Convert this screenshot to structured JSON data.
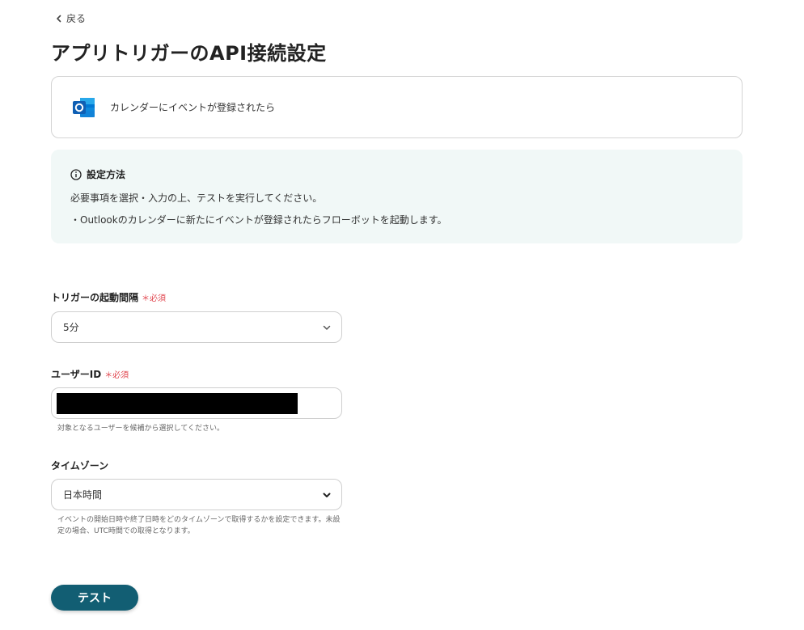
{
  "nav": {
    "back_label": "戻る"
  },
  "page": {
    "title": "アプリトリガーのAPI接続設定"
  },
  "trigger": {
    "app_icon": "outlook-icon",
    "label": "カレンダーにイベントが登録されたら"
  },
  "info": {
    "heading": "設定方法",
    "lines": [
      "必要事項を選択・入力の上、テストを実行してください。",
      "・Outlookのカレンダーに新たにイベントが登録されたらフローボットを起動します。"
    ]
  },
  "fields": {
    "interval": {
      "label": "トリガーの起動間隔",
      "required": "＊必須",
      "value": "5分"
    },
    "user_id": {
      "label": "ユーザーID",
      "required": "＊必須",
      "value": "",
      "help": "対象となるユーザーを候補から選択してください。"
    },
    "timezone": {
      "label": "タイムゾーン",
      "value": "日本時間",
      "help": "イベントの開始日時や終了日時をどのタイムゾーンで取得するかを設定できます。未設定の場合、UTC時間での取得となります。"
    }
  },
  "actions": {
    "test_label": "テスト"
  },
  "colors": {
    "primary": "#125e73",
    "required": "#e0424b",
    "info_bg": "#f1f8f7",
    "outlook_blue": "#0a64c6"
  }
}
